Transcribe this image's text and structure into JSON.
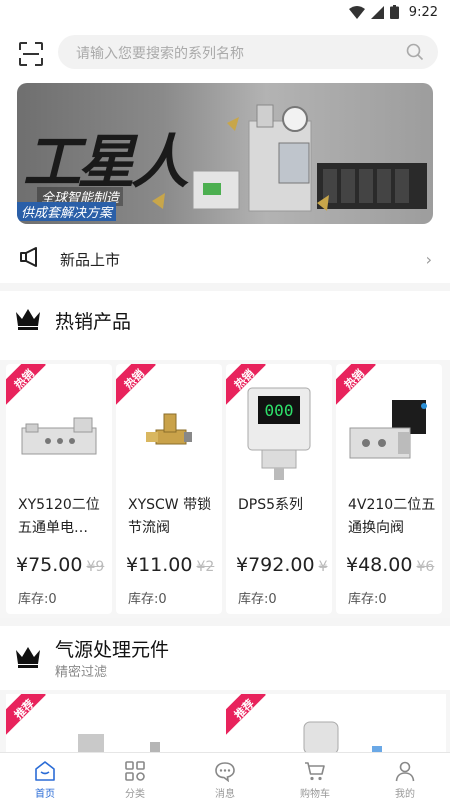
{
  "status_bar": {
    "time": "9:22"
  },
  "search": {
    "placeholder": "请输入您要搜索的系列名称"
  },
  "banner": {
    "headline": "工星人",
    "tagline1": "全球智能制造",
    "tagline2": "供成套解决方案"
  },
  "notice": {
    "label": "新品上市"
  },
  "hot_section": {
    "title": "热销产品"
  },
  "products": [
    {
      "badge": "热销",
      "name": "XY5120二位五通单电…",
      "price": "¥75.00",
      "old_price": "¥9",
      "stock": "库存:0",
      "icon": "solenoid-valve-icon"
    },
    {
      "badge": "热销",
      "name": "XYSCW 带锁节流阀",
      "price": "¥11.00",
      "old_price": "¥2",
      "stock": "库存:0",
      "icon": "throttle-valve-icon"
    },
    {
      "badge": "热销",
      "name": "DPS5系列",
      "price": "¥792.00",
      "old_price": "¥",
      "stock": "库存:0",
      "icon": "pressure-switch-icon"
    },
    {
      "badge": "热销",
      "name": "4V210二位五通换向阀",
      "price": "¥48.00",
      "old_price": "¥6",
      "stock": "库存:0",
      "icon": "directional-valve-icon"
    }
  ],
  "air_section": {
    "title": "气源处理元件",
    "subtitle": "精密过滤"
  },
  "recommend": [
    {
      "badge": "推荐"
    },
    {
      "badge": "推荐"
    }
  ],
  "tabbar": [
    {
      "label": "首页",
      "icon": "home-icon",
      "active": true
    },
    {
      "label": "分类",
      "icon": "category-icon",
      "active": false
    },
    {
      "label": "消息",
      "icon": "message-icon",
      "active": false
    },
    {
      "label": "购物车",
      "icon": "cart-icon",
      "active": false
    },
    {
      "label": "我的",
      "icon": "user-icon",
      "active": false
    }
  ],
  "colors": {
    "accent": "#2b6cd6",
    "badge": "#e8235c",
    "text": "#222222"
  }
}
